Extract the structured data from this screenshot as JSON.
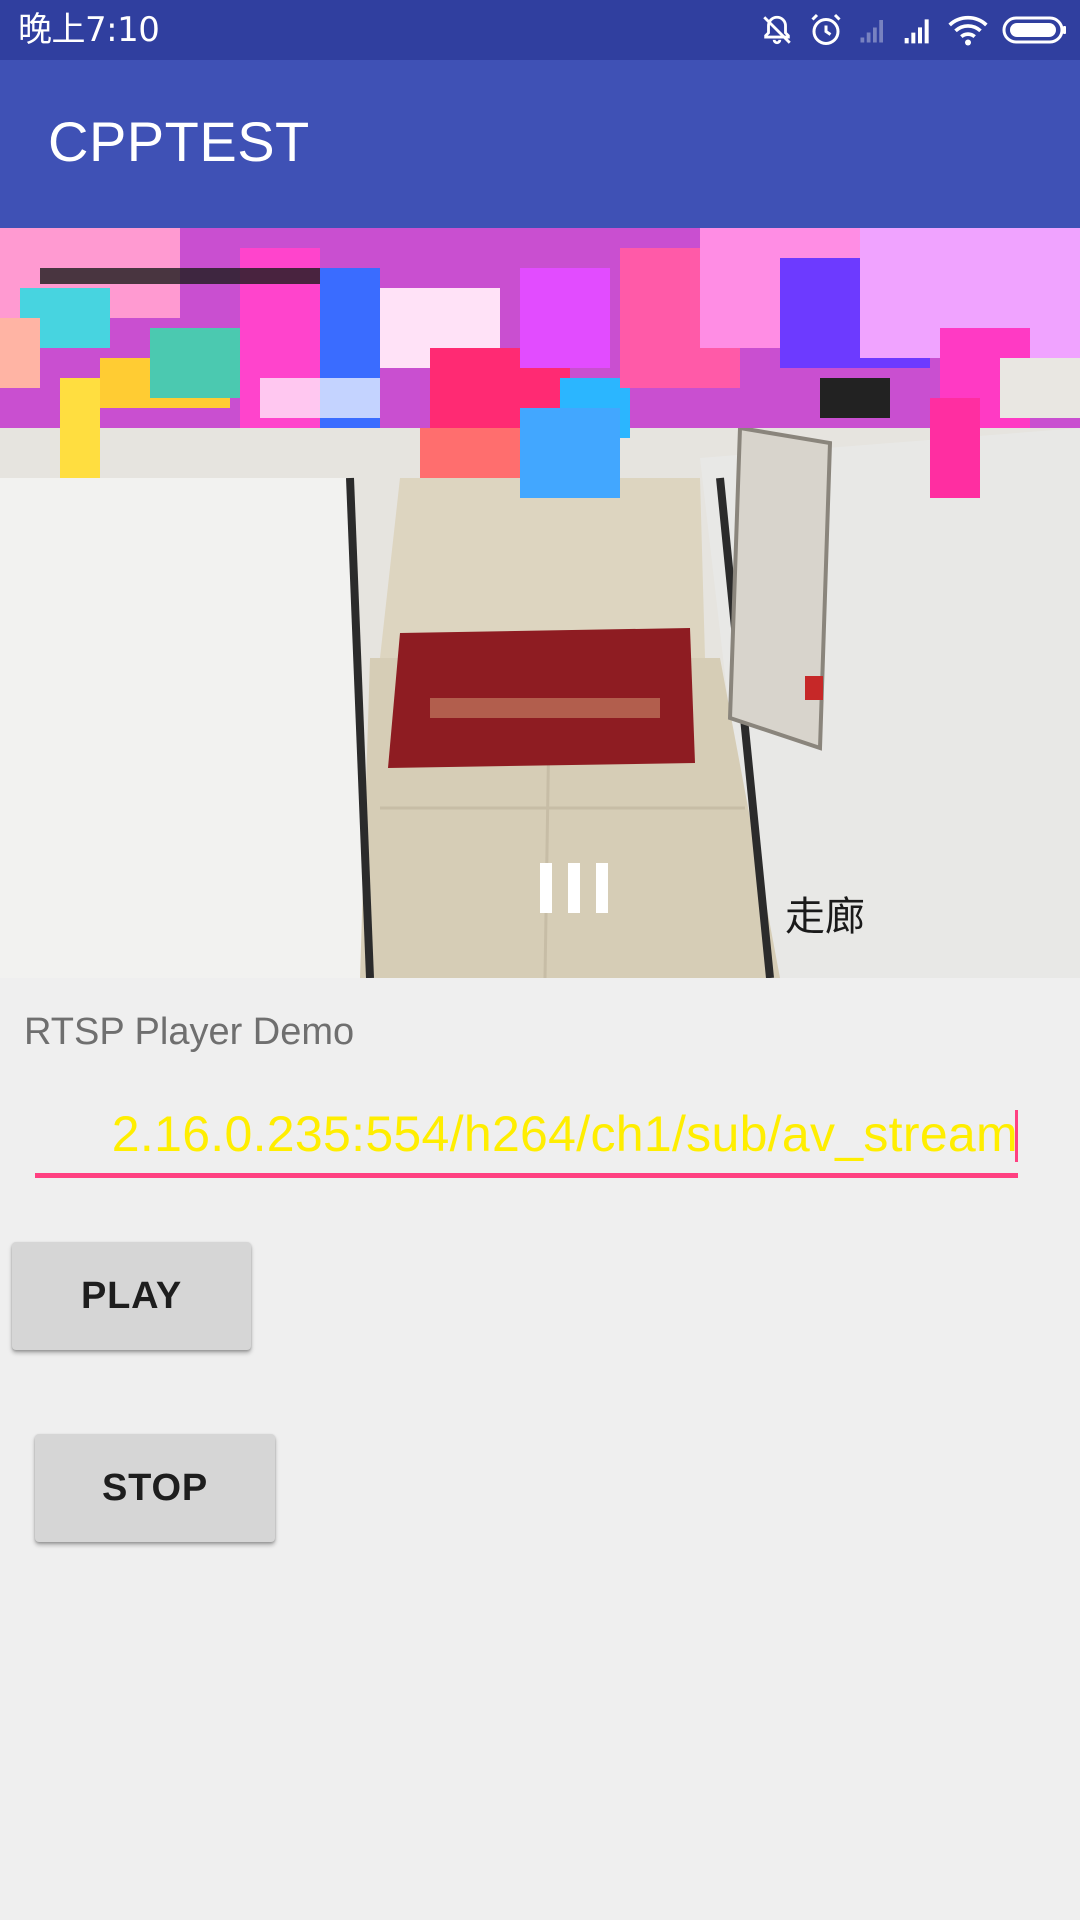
{
  "status_bar": {
    "time": "晚上7:10",
    "icons": [
      "bell-off-icon",
      "alarm-icon",
      "signal-weak-icon",
      "signal-icon",
      "wifi-icon",
      "battery-icon"
    ]
  },
  "toolbar": {
    "title": "CPPTEST"
  },
  "video": {
    "overlay_label": "走廊"
  },
  "main": {
    "demo_label": "RTSP Player Demo",
    "url_input_value": "2.16.0.235:554/h264/ch1/sub/av_stream",
    "play_label": "PLAY",
    "stop_label": "STOP"
  },
  "colors": {
    "status_bar": "#303f9f",
    "toolbar": "#3f51b5",
    "accent": "#ff4081",
    "url_text": "#ffee00",
    "background": "#efefef"
  }
}
